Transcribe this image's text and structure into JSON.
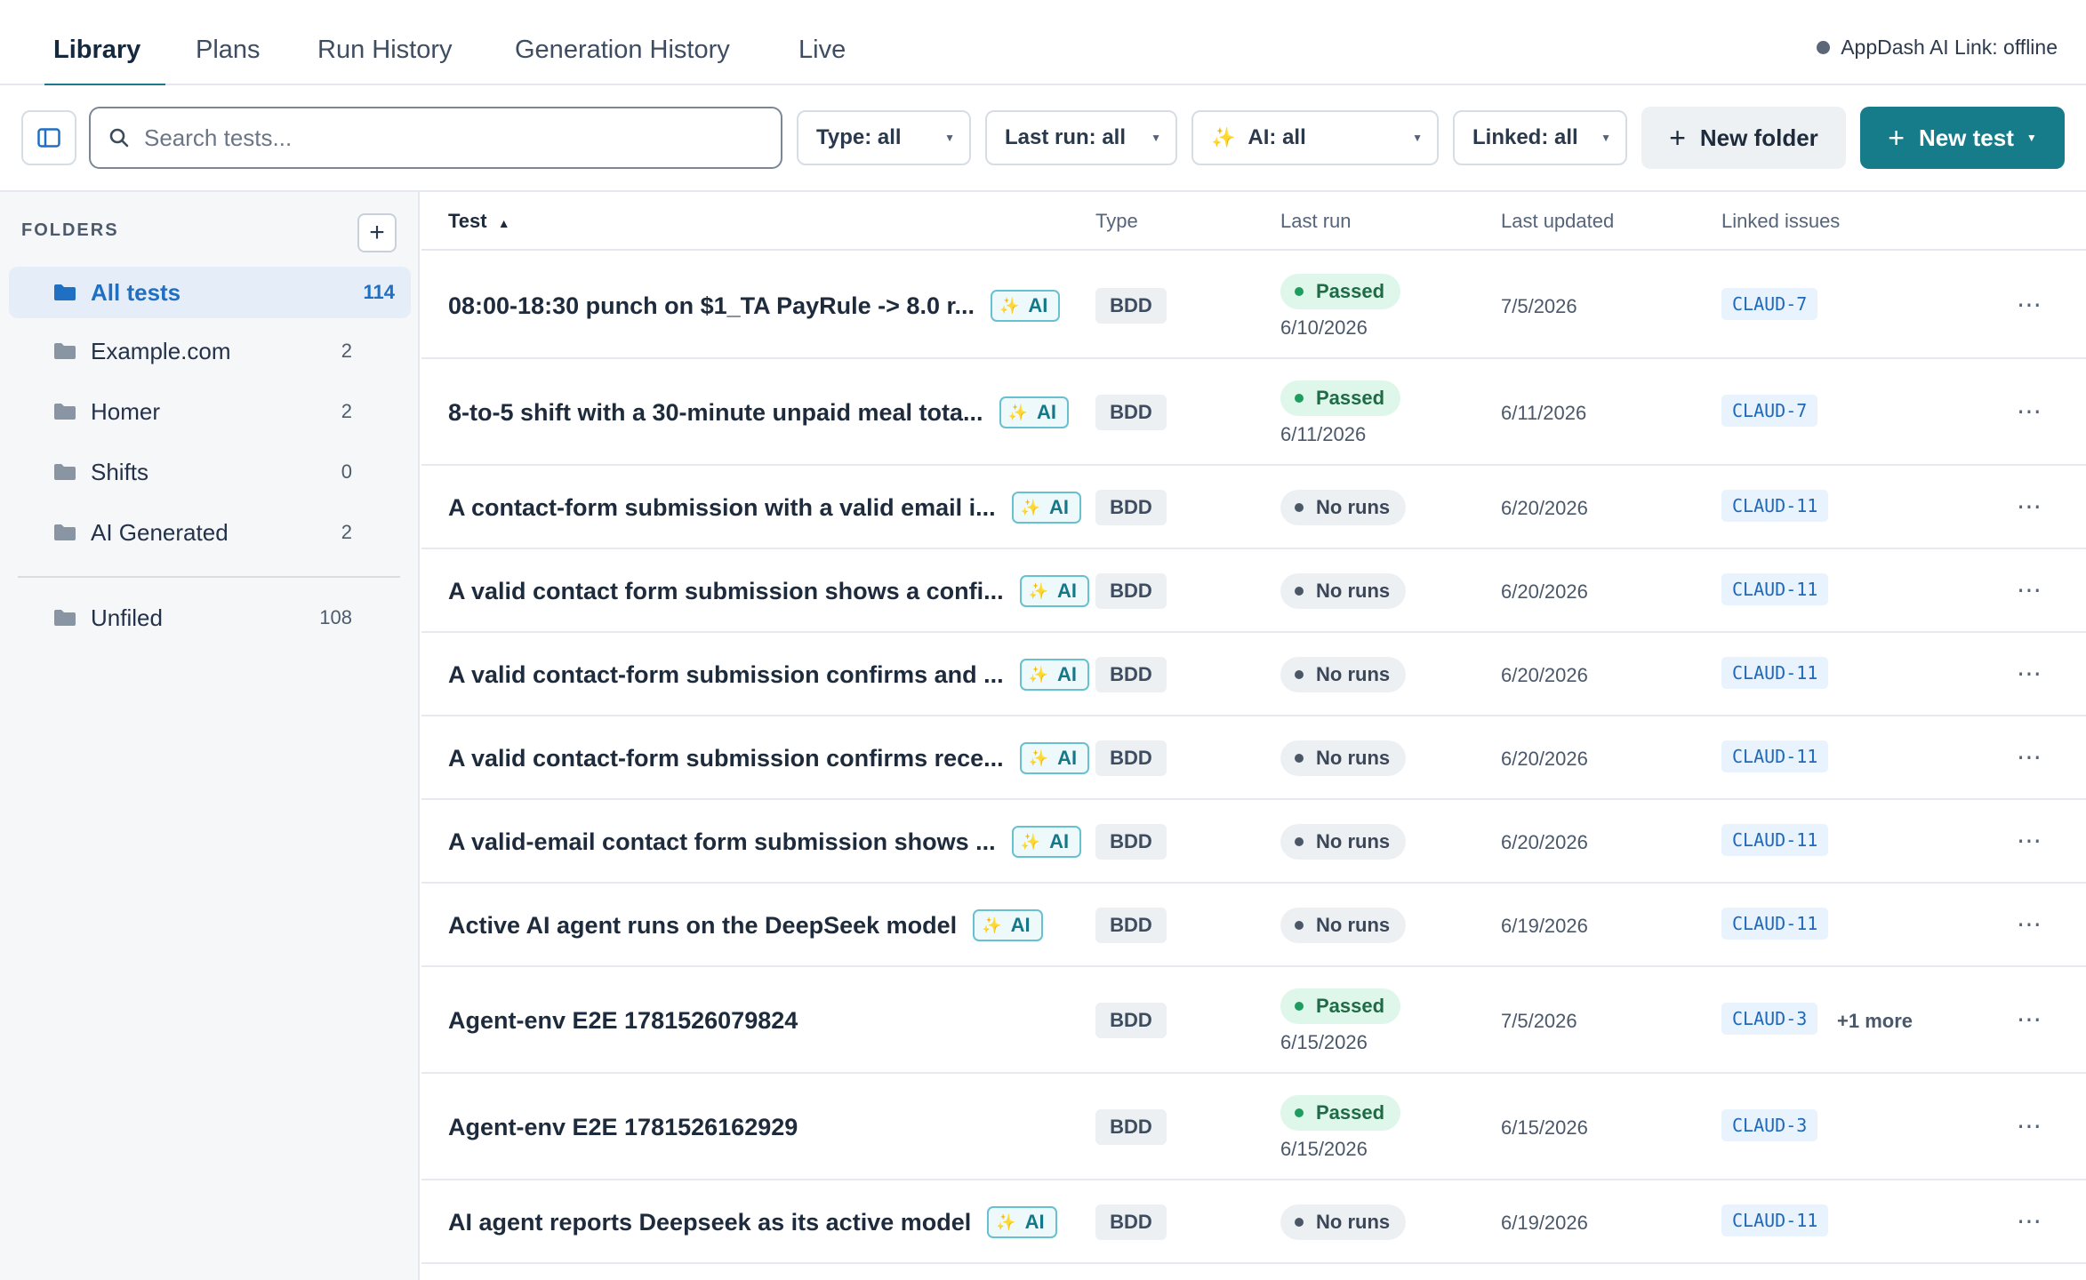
{
  "nav": {
    "tabs": [
      {
        "label": "Library",
        "active": true
      },
      {
        "label": "Plans"
      },
      {
        "label": "Run History"
      },
      {
        "label": "Generation History"
      },
      {
        "label": "Live"
      }
    ],
    "status_text": "AppDash AI Link: offline"
  },
  "toolbar": {
    "search_placeholder": "Search tests...",
    "filters": {
      "type": "Type: all",
      "last_run": "Last run: all",
      "ai": "AI: all",
      "linked": "Linked: all"
    },
    "new_folder_label": "New folder",
    "new_test_label": "New test"
  },
  "sidebar": {
    "heading": "FOLDERS",
    "folders": [
      {
        "name": "All tests",
        "count": "114",
        "active": true
      },
      {
        "name": "Example.com",
        "count": "2"
      },
      {
        "name": "Homer",
        "count": "2"
      },
      {
        "name": "Shifts",
        "count": "0"
      },
      {
        "name": "AI Generated",
        "count": "2"
      }
    ],
    "unfiled": {
      "name": "Unfiled",
      "count": "108"
    }
  },
  "table": {
    "columns": {
      "test": "Test",
      "type": "Type",
      "last_run": "Last run",
      "last_updated": "Last updated",
      "linked_issues": "Linked issues"
    },
    "ai_label": "AI",
    "rows": [
      {
        "name": "08:00-18:30 punch on $1_TA PayRule -> 8.0 r...",
        "ai": true,
        "type": "BDD",
        "status": "Passed",
        "run_date": "6/10/2026",
        "updated": "7/5/2026",
        "issue": "CLAUD-7",
        "more": ""
      },
      {
        "name": "8-to-5 shift with a 30-minute unpaid meal tota...",
        "ai": true,
        "type": "BDD",
        "status": "Passed",
        "run_date": "6/11/2026",
        "updated": "6/11/2026",
        "issue": "CLAUD-7",
        "more": ""
      },
      {
        "name": "A contact-form submission with a valid email i...",
        "ai": true,
        "type": "BDD",
        "status": "No runs",
        "run_date": "",
        "updated": "6/20/2026",
        "issue": "CLAUD-11",
        "more": ""
      },
      {
        "name": "A valid contact form submission shows a confi...",
        "ai": true,
        "type": "BDD",
        "status": "No runs",
        "run_date": "",
        "updated": "6/20/2026",
        "issue": "CLAUD-11",
        "more": ""
      },
      {
        "name": "A valid contact-form submission confirms and ...",
        "ai": true,
        "type": "BDD",
        "status": "No runs",
        "run_date": "",
        "updated": "6/20/2026",
        "issue": "CLAUD-11",
        "more": ""
      },
      {
        "name": "A valid contact-form submission confirms rece...",
        "ai": true,
        "type": "BDD",
        "status": "No runs",
        "run_date": "",
        "updated": "6/20/2026",
        "issue": "CLAUD-11",
        "more": ""
      },
      {
        "name": "A valid-email contact form submission shows ...",
        "ai": true,
        "type": "BDD",
        "status": "No runs",
        "run_date": "",
        "updated": "6/20/2026",
        "issue": "CLAUD-11",
        "more": ""
      },
      {
        "name": "Active AI agent runs on the DeepSeek model",
        "ai": true,
        "type": "BDD",
        "status": "No runs",
        "run_date": "",
        "updated": "6/19/2026",
        "issue": "CLAUD-11",
        "more": ""
      },
      {
        "name": "Agent-env E2E 1781526079824",
        "ai": false,
        "type": "BDD",
        "status": "Passed",
        "run_date": "6/15/2026",
        "updated": "7/5/2026",
        "issue": "CLAUD-3",
        "more": "+1 more"
      },
      {
        "name": "Agent-env E2E 1781526162929",
        "ai": false,
        "type": "BDD",
        "status": "Passed",
        "run_date": "6/15/2026",
        "updated": "6/15/2026",
        "issue": "CLAUD-3",
        "more": ""
      },
      {
        "name": "AI agent reports Deepseek as its active model",
        "ai": true,
        "type": "BDD",
        "status": "No runs",
        "run_date": "",
        "updated": "6/19/2026",
        "issue": "CLAUD-11",
        "more": ""
      }
    ]
  }
}
